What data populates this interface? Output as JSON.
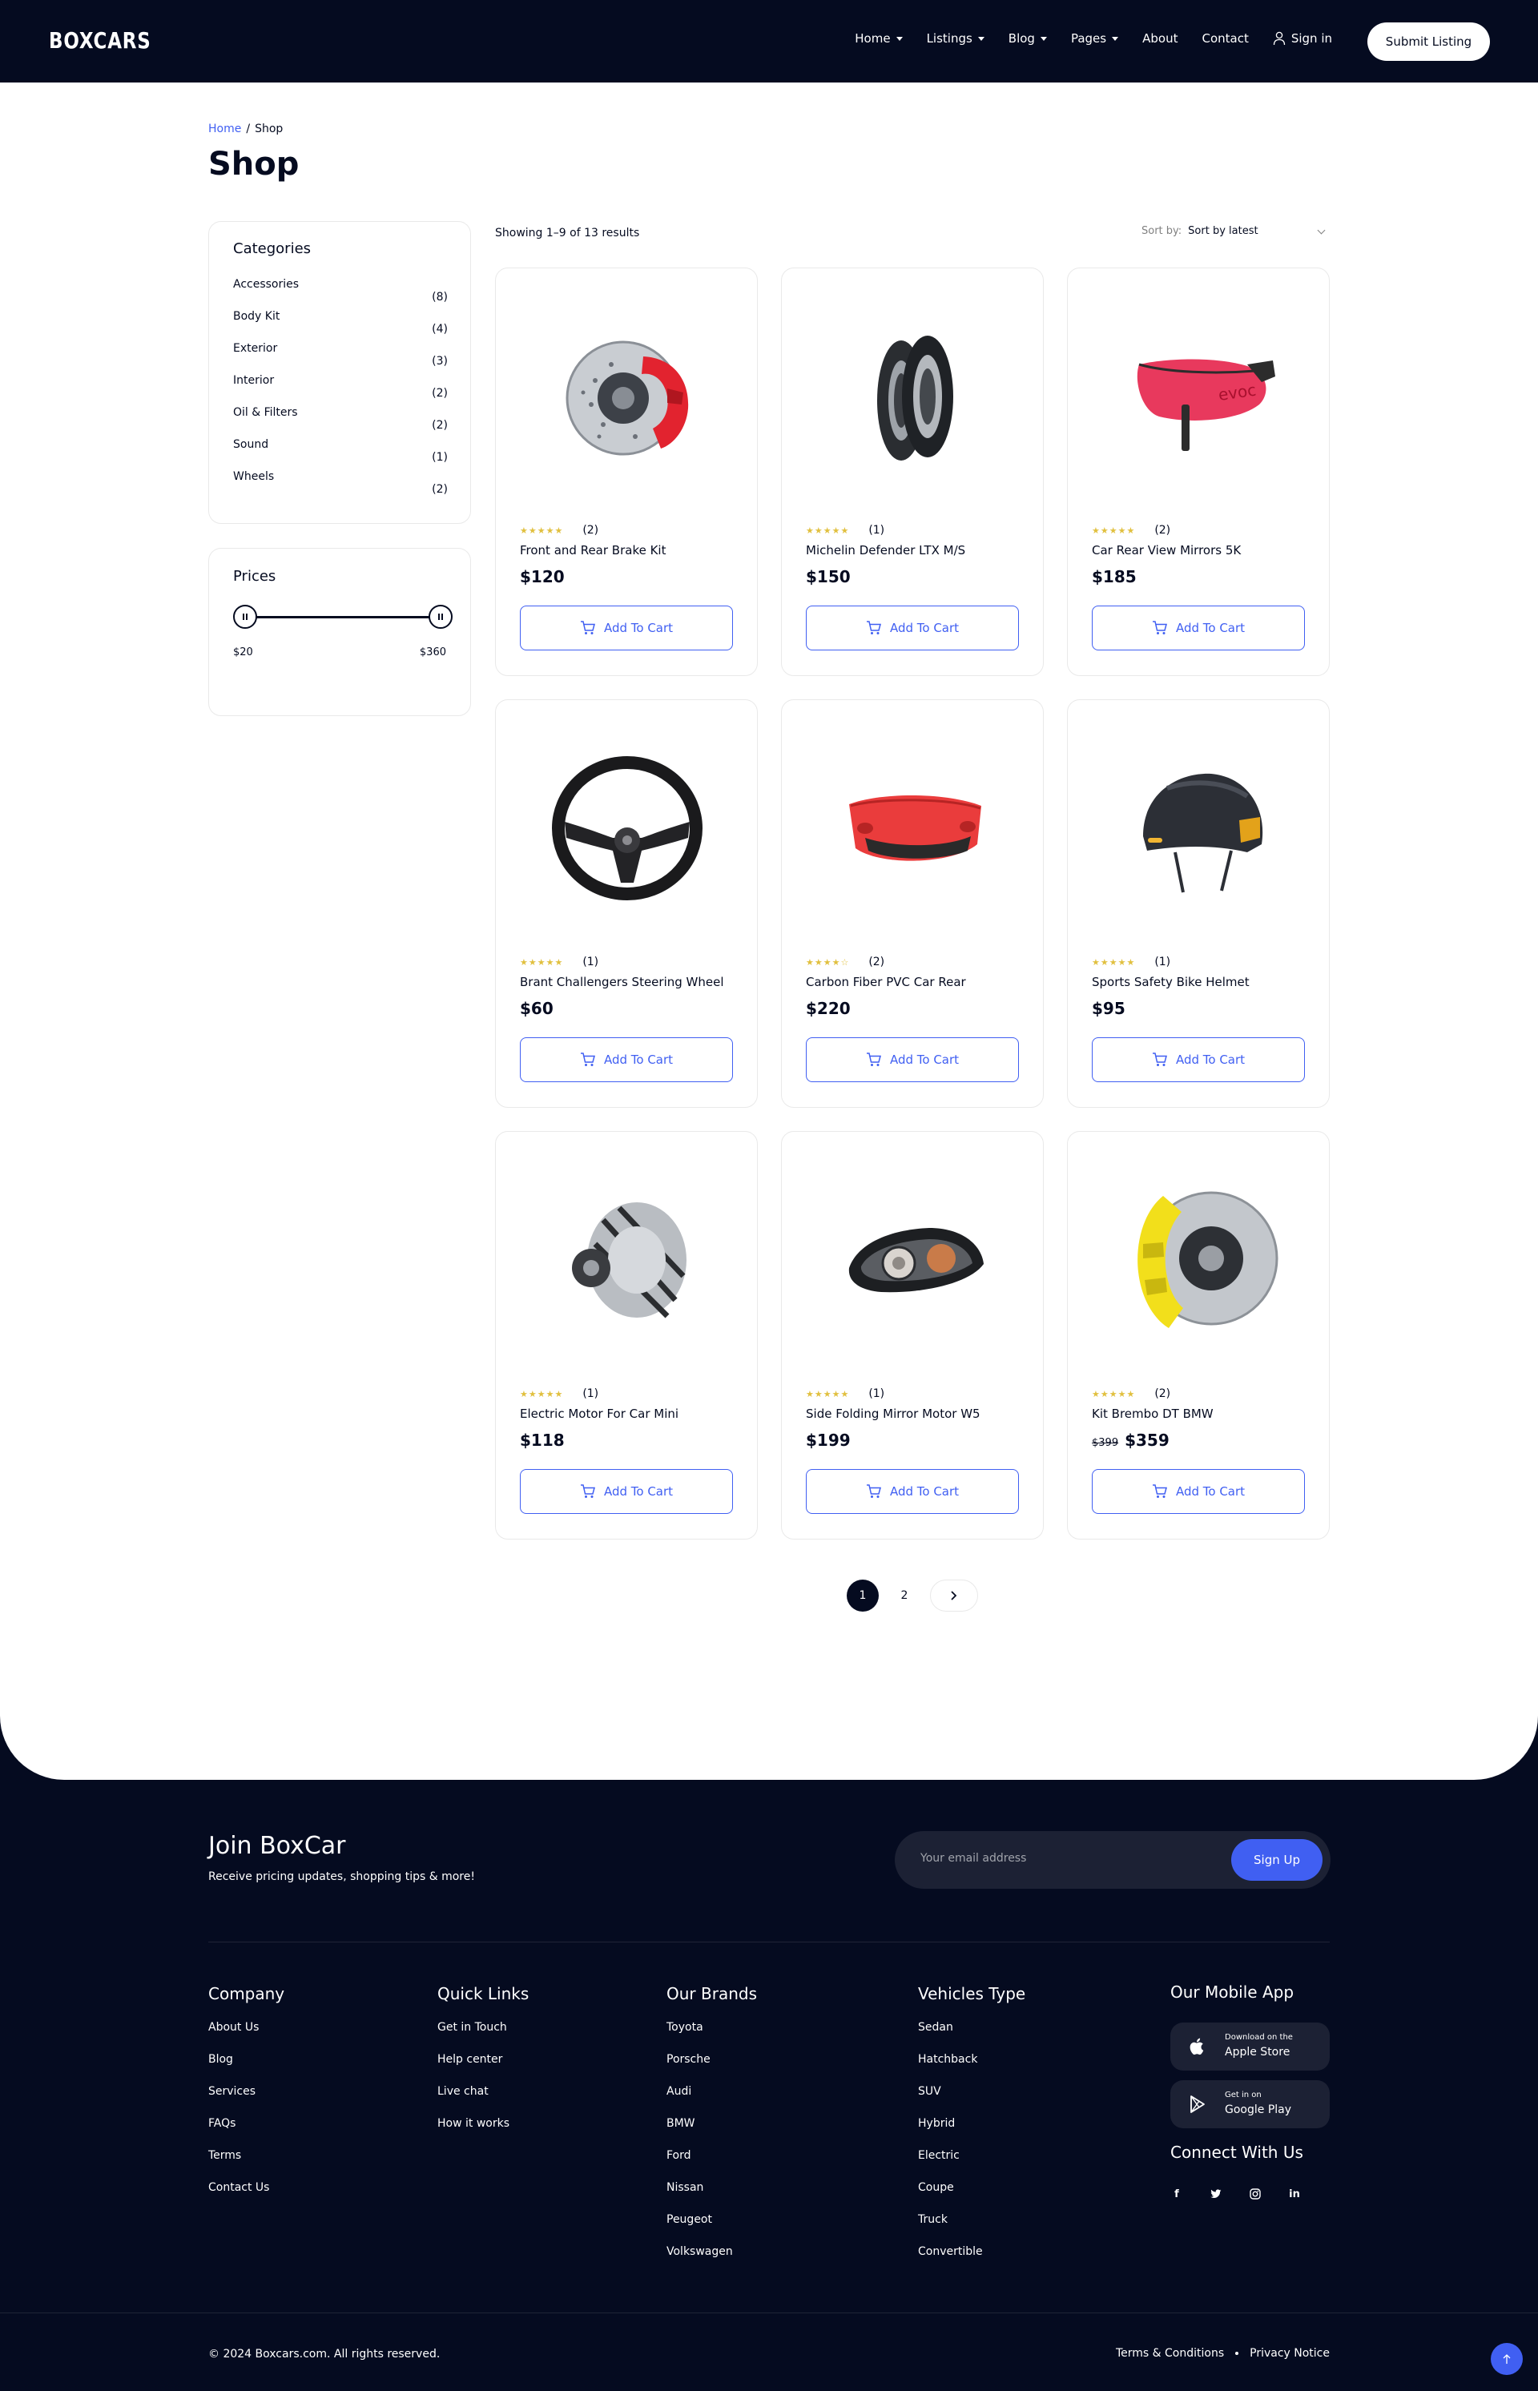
{
  "header": {
    "logo": "BOXCARS",
    "nav": [
      {
        "label": "Home",
        "dropdown": true
      },
      {
        "label": "Listings",
        "dropdown": true
      },
      {
        "label": "Blog",
        "dropdown": true
      },
      {
        "label": "Pages",
        "dropdown": true
      },
      {
        "label": "About",
        "dropdown": false
      },
      {
        "label": "Contact",
        "dropdown": false
      }
    ],
    "sign_in": "Sign in",
    "submit_listing": "Submit Listing"
  },
  "breadcrumb": {
    "home": "Home",
    "separator": "/",
    "current": "Shop"
  },
  "page_title": "Shop",
  "sidebar": {
    "categories_title": "Categories",
    "categories": [
      {
        "name": "Accessories",
        "count": "(8)"
      },
      {
        "name": "Body Kit",
        "count": "(4)"
      },
      {
        "name": "Exterior",
        "count": "(3)"
      },
      {
        "name": "Interior",
        "count": "(2)"
      },
      {
        "name": "Oil & Filters",
        "count": "(2)"
      },
      {
        "name": "Sound",
        "count": "(1)"
      },
      {
        "name": "Wheels",
        "count": "(2)"
      }
    ],
    "prices_title": "Prices",
    "price_min": "$20",
    "price_max": "$360"
  },
  "toolbar": {
    "showing": "Showing 1–9 of 13 results",
    "sort_label": "Sort by:",
    "sort_value": "Sort by latest"
  },
  "products": [
    {
      "title": "Front and Rear Brake Kit",
      "price": "$120",
      "old_price": "",
      "reviews": "(2)",
      "rating": 5,
      "image": "brake-disc-red"
    },
    {
      "title": "Michelin Defender LTX M/S",
      "price": "$150",
      "old_price": "",
      "reviews": "(1)",
      "rating": 5,
      "image": "motorcycle-tires"
    },
    {
      "title": "Car Rear View Mirrors 5K",
      "price": "$185",
      "old_price": "",
      "reviews": "(2)",
      "rating": 5,
      "image": "saddle-bag-red"
    },
    {
      "title": "Brant Challengers Steering Wheel",
      "price": "$60",
      "old_price": "",
      "reviews": "(1)",
      "rating": 5,
      "image": "steering-wheel"
    },
    {
      "title": "Carbon Fiber PVC Car Rear",
      "price": "$220",
      "old_price": "",
      "reviews": "(2)",
      "rating": 4.5,
      "image": "red-bumper"
    },
    {
      "title": "Sports Safety Bike Helmet",
      "price": "$95",
      "old_price": "",
      "reviews": "(1)",
      "rating": 5,
      "image": "bike-helmet"
    },
    {
      "title": "Electric Motor For Car Mini",
      "price": "$118",
      "old_price": "",
      "reviews": "(1)",
      "rating": 5,
      "image": "alternator"
    },
    {
      "title": "Side Folding Mirror Motor W5",
      "price": "$199",
      "old_price": "",
      "reviews": "(1)",
      "rating": 5,
      "image": "headlight"
    },
    {
      "title": "Kit Brembo DT BMW",
      "price": "$359",
      "old_price": "$399",
      "reviews": "(2)",
      "rating": 5,
      "image": "brake-disc-yellow"
    }
  ],
  "add_to_cart_label": "Add To Cart",
  "pagination": {
    "pages": [
      "1",
      "2"
    ],
    "active": "1"
  },
  "footer": {
    "join_title": "Join BoxCar",
    "join_subtitle": "Receive pricing updates, shopping tips & more!",
    "email_placeholder": "Your email address",
    "signup_label": "Sign Up",
    "columns": [
      {
        "title": "Company",
        "links": [
          "About Us",
          "Blog",
          "Services",
          "FAQs",
          "Terms",
          "Contact Us"
        ]
      },
      {
        "title": "Quick Links",
        "links": [
          "Get in Touch",
          "Help center",
          "Live chat",
          "How it works"
        ]
      },
      {
        "title": "Our Brands",
        "links": [
          "Toyota",
          "Porsche",
          "Audi",
          "BMW",
          "Ford",
          "Nissan",
          "Peugeot",
          "Volkswagen"
        ]
      },
      {
        "title": "Vehicles Type",
        "links": [
          "Sedan",
          "Hatchback",
          "SUV",
          "Hybrid",
          "Electric",
          "Coupe",
          "Truck",
          "Convertible"
        ]
      }
    ],
    "app_title": "Our Mobile App",
    "apple": {
      "small": "Download on the",
      "big": "Apple Store"
    },
    "google": {
      "small": "Get in on",
      "big": "Google Play"
    },
    "connect_title": "Connect With Us",
    "socials": [
      "facebook-icon",
      "twitter-icon",
      "instagram-icon",
      "linkedin-icon"
    ],
    "copyright": "© 2024 Boxcars.com. All rights reserved.",
    "terms": "Terms & Conditions",
    "privacy": "Privacy Notice"
  },
  "colors": {
    "navy": "#050b20",
    "accent": "#405ff2",
    "star": "#e1c03f",
    "border": "#e9e9e9"
  }
}
